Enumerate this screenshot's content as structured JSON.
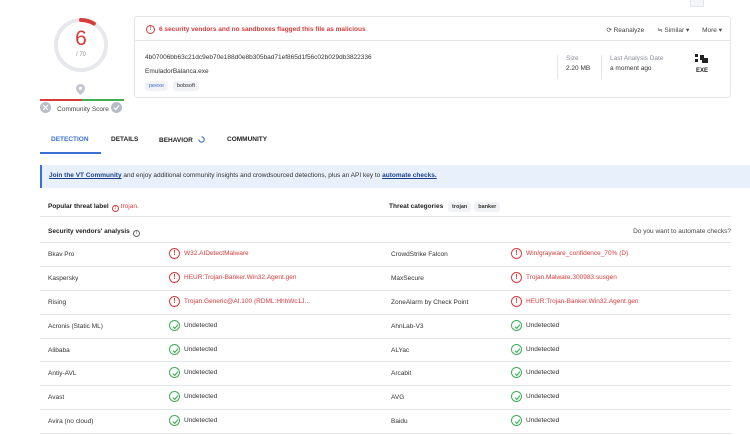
{
  "score": {
    "detections": "6",
    "total": "/ 70",
    "community_label": "Community Score",
    "gauge_fraction": 0.0857
  },
  "alert": {
    "icon": "alert-circle-icon",
    "text": "6 security vendors and no sandboxes flagged this file as malicious"
  },
  "actions": {
    "reanalyze": "⟳ Reanalyze",
    "similar": "≒ Similar ▾",
    "more": "More ▾"
  },
  "file": {
    "hash": "4b07006bb63c21dc9eb70e188d0e8b305bad71ef865d1f56c02b029db3822336",
    "name": "EmuladorBalanca.exe",
    "tags": [
      "peexe",
      "bobsoft"
    ],
    "size_label": "Size",
    "size_value": "2.20 MB",
    "date_label": "Last Analysis Date",
    "date_value": "a moment ago",
    "type_badge": "EXE"
  },
  "tabs": [
    "DETECTION",
    "DETAILS",
    "BEHAVIOR",
    "COMMUNITY"
  ],
  "banner": {
    "link1": "Join the VT Community",
    "middle": " and enjoy additional community insights and crowdsourced detections, plus an API key to ",
    "link2": "automate checks."
  },
  "popular": {
    "label": "Popular threat label",
    "value": "trojan.",
    "categories_label": "Threat categories",
    "categories": [
      "trojan",
      "banker"
    ]
  },
  "vendors_header": {
    "label": "Security vendors' analysis",
    "automate": "Do you want to automate checks?"
  },
  "vendors": [
    {
      "name": "Bkav Pro",
      "result": "W32.AIDetectMalware",
      "malicious": true,
      "name2": "CrowdStrike Falcon",
      "result2": "Win/grayware_confidence_70% (D)",
      "malicious2": true
    },
    {
      "name": "Kaspersky",
      "result": "HEUR:Trojan-Banker.Win32.Agent.gen",
      "malicious": true,
      "name2": "MaxSecure",
      "result2": "Trojan.Malware.300983.susgen",
      "malicious2": true
    },
    {
      "name": "Rising",
      "result": "Trojan.Generic@AI.100 (RDML:HhhWc1J...",
      "malicious": true,
      "name2": "ZoneAlarm by Check Point",
      "result2": "HEUR:Trojan-Banker.Win32.Agent.gen",
      "malicious2": true
    },
    {
      "name": "Acronis (Static ML)",
      "result": "Undetected",
      "malicious": false,
      "name2": "AhnLab-V3",
      "result2": "Undetected",
      "malicious2": false
    },
    {
      "name": "Alibaba",
      "result": "Undetected",
      "malicious": false,
      "name2": "ALYac",
      "result2": "Undetected",
      "malicious2": false
    },
    {
      "name": "Antiy-AVL",
      "result": "Undetected",
      "malicious": false,
      "name2": "Arcabit",
      "result2": "Undetected",
      "malicious2": false
    },
    {
      "name": "Avast",
      "result": "Undetected",
      "malicious": false,
      "name2": "AVG",
      "result2": "Undetected",
      "malicious2": false
    },
    {
      "name": "Avira (no cloud)",
      "result": "Undetected",
      "malicious": false,
      "name2": "Baidu",
      "result2": "Undetected",
      "malicious2": false
    }
  ],
  "colors": {
    "accent": "#3b6fd6",
    "danger": "#d93b3b",
    "success": "#3fae55"
  }
}
